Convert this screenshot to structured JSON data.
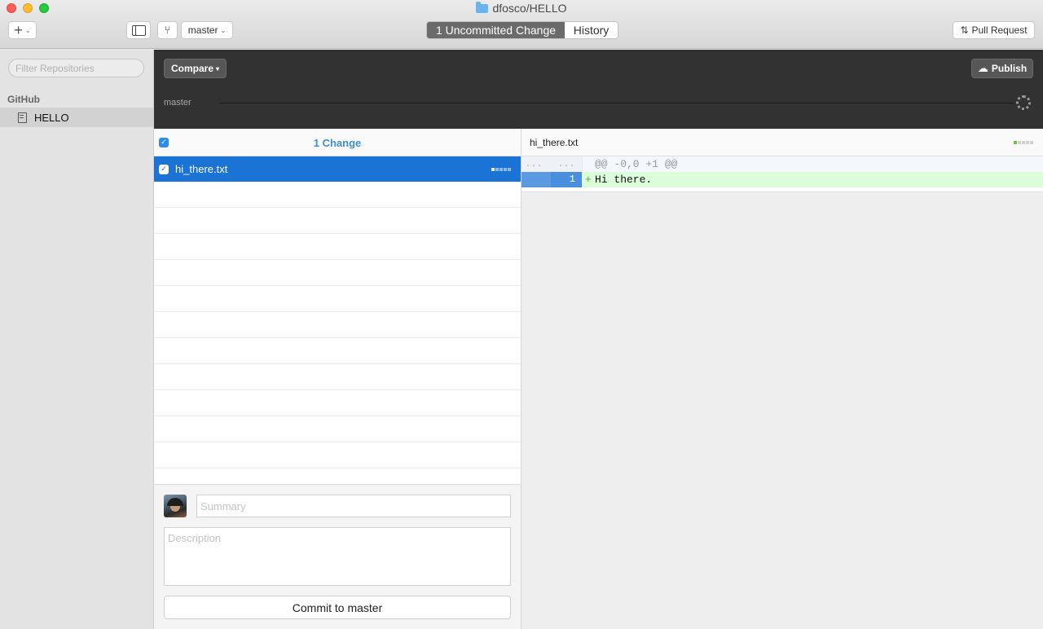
{
  "window": {
    "title": "dfosco/HELLO"
  },
  "toolbar": {
    "add_label": "+",
    "branch_label": "master",
    "segments": [
      "1 Uncommitted Change",
      "History"
    ],
    "pull_request_label": "Pull Request"
  },
  "sidebar": {
    "filter_placeholder": "Filter Repositories",
    "section": "GitHub",
    "repos": [
      {
        "label": "HELLO",
        "selected": true
      }
    ]
  },
  "compare_bar": {
    "compare_label": "Compare",
    "publish_label": "Publish",
    "branch": "master"
  },
  "changes": {
    "count_label": "1 Change",
    "files": [
      {
        "name": "hi_there.txt",
        "checked": true,
        "selected": true
      }
    ]
  },
  "commit": {
    "summary_placeholder": "Summary",
    "description_placeholder": "Description",
    "button_label": "Commit to master"
  },
  "diff": {
    "filename": "hi_there.txt",
    "hunk_old_ln": "...",
    "hunk_new_ln": "...",
    "hunk_header": "@@ -0,0 +1 @@",
    "lines": [
      {
        "old": "",
        "new": "1",
        "sign": "+",
        "text": "Hi there."
      }
    ]
  },
  "colors": {
    "accent": "#1c73d6",
    "addition": "#dbffdb",
    "dark_bar": "#323232"
  }
}
